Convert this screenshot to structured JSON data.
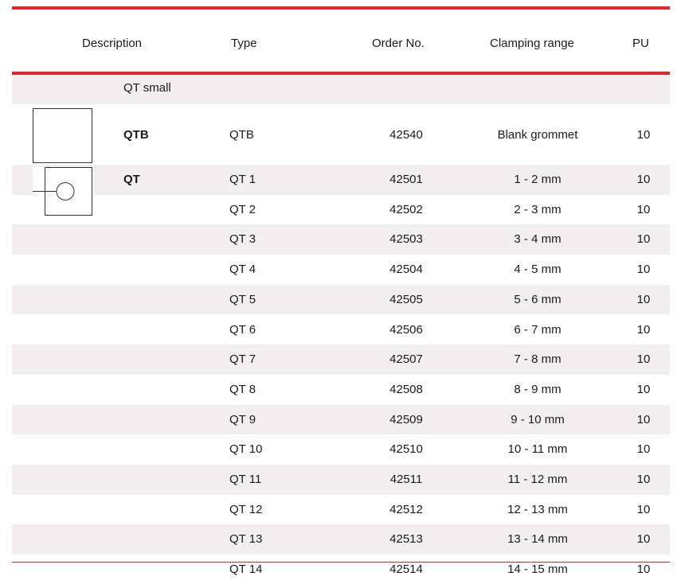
{
  "colors": {
    "accent": "#e3262e",
    "band": "#f1eff0"
  },
  "headers": {
    "description": "Description",
    "type": "Type",
    "order_no": "Order No.",
    "clamping_range": "Clamping range",
    "pu": "PU"
  },
  "group_label": "QT small",
  "blank_item": {
    "desc": "QTB",
    "type": "QTB",
    "order": "42540",
    "clamp": "Blank grommet",
    "pu": "10"
  },
  "qt_desc": "QT",
  "rows": [
    {
      "type": "QT 1",
      "order": "42501",
      "clamp": "1 - 2 mm",
      "pu": "10"
    },
    {
      "type": "QT 2",
      "order": "42502",
      "clamp": "2 - 3 mm",
      "pu": "10"
    },
    {
      "type": "QT 3",
      "order": "42503",
      "clamp": "3 - 4 mm",
      "pu": "10"
    },
    {
      "type": "QT 4",
      "order": "42504",
      "clamp": "4 - 5 mm",
      "pu": "10"
    },
    {
      "type": "QT 5",
      "order": "42505",
      "clamp": "5 - 6 mm",
      "pu": "10"
    },
    {
      "type": "QT 6",
      "order": "42506",
      "clamp": "6 - 7 mm",
      "pu": "10"
    },
    {
      "type": "QT 7",
      "order": "42507",
      "clamp": "7 - 8 mm",
      "pu": "10"
    },
    {
      "type": "QT 8",
      "order": "42508",
      "clamp": "8 - 9 mm",
      "pu": "10"
    },
    {
      "type": "QT 9",
      "order": "42509",
      "clamp": "9 - 10 mm",
      "pu": "10"
    },
    {
      "type": "QT 10",
      "order": "42510",
      "clamp": "10 - 11 mm",
      "pu": "10"
    },
    {
      "type": "QT 11",
      "order": "42511",
      "clamp": "11 - 12 mm",
      "pu": "10"
    },
    {
      "type": "QT 12",
      "order": "42512",
      "clamp": "12 - 13 mm",
      "pu": "10"
    },
    {
      "type": "QT 13",
      "order": "42513",
      "clamp": "13 - 14 mm",
      "pu": "10"
    },
    {
      "type": "QT 14",
      "order": "42514",
      "clamp": "14 - 15 mm",
      "pu": "10"
    }
  ]
}
